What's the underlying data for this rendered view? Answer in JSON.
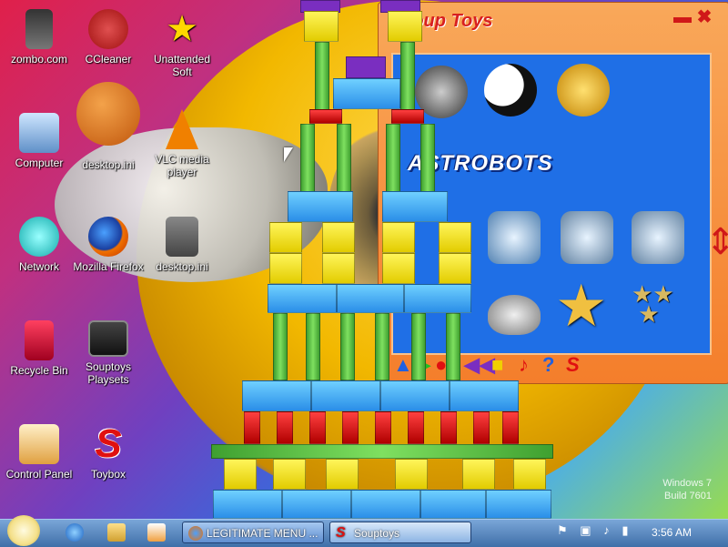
{
  "desktop_icons": [
    {
      "label": "zombo.com",
      "icon": "building-icon"
    },
    {
      "label": "CCleaner",
      "icon": "ccleaner-icon"
    },
    {
      "label": "Unattended Soft",
      "icon": "star-icon"
    },
    {
      "label": "Computer",
      "icon": "computer-icon"
    },
    {
      "label": "desktop.ini",
      "icon": "basketball-icon"
    },
    {
      "label": "VLC media player",
      "icon": "vlc-cone-icon"
    },
    {
      "label": "Network",
      "icon": "network-globe-icon"
    },
    {
      "label": "Mozilla Firefox",
      "icon": "firefox-icon"
    },
    {
      "label": "desktop.ini",
      "icon": "file-icon"
    },
    {
      "label": "Recycle Bin",
      "icon": "recycle-bin-icon"
    },
    {
      "label": "Souptoys Playsets",
      "icon": "playsets-icon"
    },
    {
      "label": "Control Panel",
      "icon": "control-panel-icon"
    },
    {
      "label": "Toybox",
      "icon": "toybox-s-icon"
    }
  ],
  "souptoys_window": {
    "logo": "Soup Toys",
    "category_title": "ASTROBOTS",
    "close_symbol": "✖",
    "minimize_symbol": "▬",
    "toys": [
      "buckets-icon",
      "yin-yang-icon",
      "gold-coin-icon",
      "robot-icon",
      "robot-icon",
      "robot-icon",
      "ufo-icon",
      "star-icon",
      "stars-icon"
    ],
    "toolbar": [
      "▲",
      "▶",
      "●",
      "◀◀",
      "■",
      "♪",
      "?",
      "S"
    ]
  },
  "watermark": {
    "line1": "Windows 7",
    "line2": "Build 7601"
  },
  "taskbar": {
    "buttons": [
      {
        "label": "LEGITIMATE MENU ...",
        "icon": "firefox-icon"
      },
      {
        "label": "Souptoys",
        "icon": "souptoys-icon"
      }
    ],
    "clock": "3:56 AM"
  },
  "colors": {
    "block_blue": "#2a8ee8",
    "block_yellow": "#f5e020",
    "block_green": "#4fbf3a",
    "block_red": "#d00000",
    "window_orange": "#f47e2b"
  }
}
